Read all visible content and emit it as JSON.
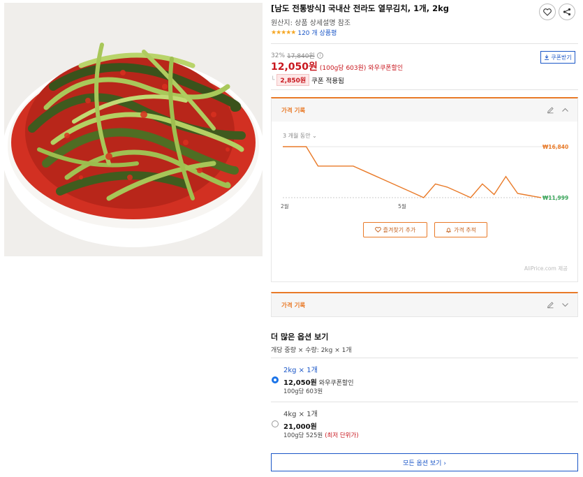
{
  "product": {
    "title": "[남도 전통방식] 국내산 전라도 열무김치, 1개, 2kg",
    "origin": "원산지: 상품 상세설명 참조",
    "rating_count": "120 개 상품평",
    "rating_stars": 5
  },
  "pricing": {
    "discount_percent": "32%",
    "original_price": "17,840원",
    "sale_price": "12,050원",
    "unit_price": "(100g당 603원)",
    "coupon_label": "와우쿠폰할인",
    "coupon_button": "쿠폰받기",
    "coupon_amount": "2,850원",
    "coupon_applied": "쿠폰 적용됨"
  },
  "price_history": {
    "panel_title": "가격 기록",
    "period_label": "3 개월 동안",
    "favorite_button": "즐겨찾기 추가",
    "track_button": "가격 추적",
    "credit": "AliPrice.com 제공",
    "collapsed_title": "가격 기록"
  },
  "chart_data": {
    "type": "line",
    "x": [
      "2월",
      "",
      "",
      "",
      "",
      "",
      "",
      "",
      "",
      "",
      "5월",
      "",
      "",
      "",
      "",
      "",
      "",
      "",
      "",
      "",
      "",
      "",
      ""
    ],
    "x_ticks": [
      "2월",
      "5월"
    ],
    "y_min_label": "₩11,999",
    "y_max_label": "₩16,840",
    "values": [
      16840,
      16840,
      16840,
      14999,
      14999,
      14999,
      14999,
      14500,
      14000,
      13500,
      13000,
      12500,
      12000,
      13300,
      13000,
      12500,
      11999,
      13300,
      12300,
      14000,
      12400,
      12200,
      11999
    ],
    "ylim": [
      11999,
      16840
    ],
    "grid": false,
    "line_color": "#e97a28"
  },
  "options": {
    "heading": "더 많은 옵션 보기",
    "selection": "개당 중량 × 수량: 2kg × 1개",
    "items": [
      {
        "name": "2kg × 1개",
        "price": "12,050원",
        "note": "와우쿠폰할인",
        "unit": "100g당 603원",
        "badge": "",
        "selected": true
      },
      {
        "name": "4kg × 1개",
        "price": "21,000원",
        "note": "",
        "unit": "100g당 525원",
        "badge": "(최저 단위가)",
        "selected": false
      }
    ],
    "all_button": "모든 옵션 보기 ›"
  },
  "colors": {
    "accent": "#e97a28",
    "price_red": "#c8161d",
    "link_blue": "#1a56c7",
    "selected_blue": "#1a73e8"
  }
}
